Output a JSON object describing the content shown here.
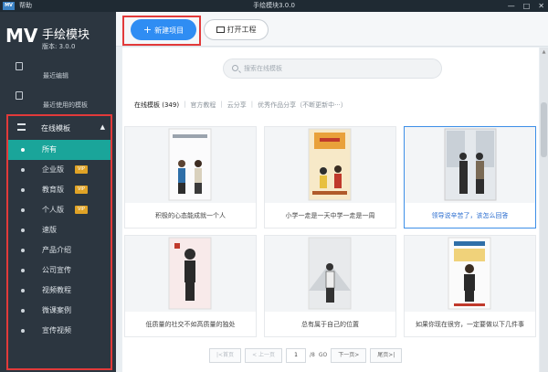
{
  "titlebar": {
    "logo": "MV",
    "help": "帮助",
    "title": "手绘模块3.0.0",
    "minimize": "—",
    "maximize": "□",
    "close": "✕"
  },
  "brand": {
    "mv": "MV",
    "name": "手绘模块",
    "version": "版本: 3.0.0"
  },
  "sidebar": {
    "recent_edit": "最近编辑",
    "recent_templates": "最近使用的模板",
    "online_templates": "在线模板",
    "categories": [
      {
        "label": "所有",
        "active": true
      },
      {
        "label": "企业版",
        "badge": "VIP"
      },
      {
        "label": "教育版",
        "badge": "VIP"
      },
      {
        "label": "个人版",
        "badge": "VIP"
      },
      {
        "label": "速版"
      },
      {
        "label": "产品介绍"
      },
      {
        "label": "公司宣传"
      },
      {
        "label": "视频教程"
      },
      {
        "label": "微课案例"
      },
      {
        "label": "宣传视频"
      }
    ]
  },
  "toolbar": {
    "new_project": "新建项目",
    "open_project": "打开工程"
  },
  "search": {
    "placeholder": "搜索在线模板"
  },
  "tabs": [
    {
      "label": "在线模板 (349)",
      "active": true
    },
    {
      "label": "官方教程"
    },
    {
      "label": "云分享"
    },
    {
      "label": "优秀作品分享（不断更新中···）"
    }
  ],
  "cards": [
    {
      "title": "积极的心态能成就一个人"
    },
    {
      "title": "小学一走是一天中学一走是一周"
    },
    {
      "title": "领导说辛苦了，该怎么回答",
      "selected": true
    },
    {
      "title": "低质量的社交不如高质量的独处"
    },
    {
      "title": "总有属于自己的位置"
    },
    {
      "title": "如果你现在很穷，一定要做以下几件事"
    }
  ],
  "pager": {
    "first": "|<首页",
    "prev": "< 上一页",
    "current": "1",
    "total": "/8",
    "go": "GO",
    "next": "下一页>",
    "last": "尾页>|"
  },
  "colors": {
    "accent": "#2f8df3",
    "sidebar_bg": "#2c3640",
    "active_teal": "#1aa59a",
    "vip": "#e0a326",
    "highlight_red": "#e23a3a"
  }
}
